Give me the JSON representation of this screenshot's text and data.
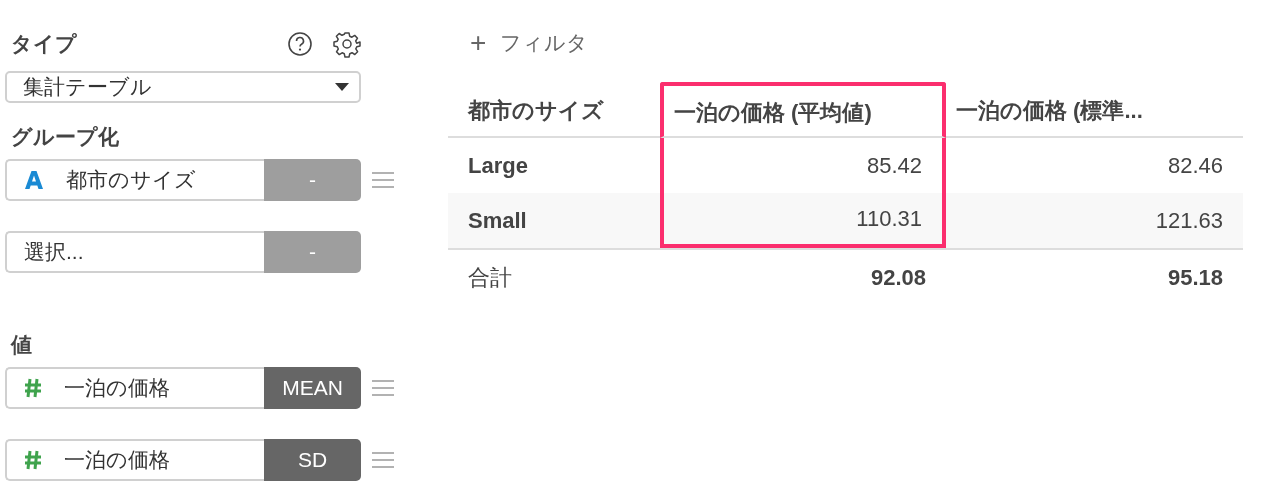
{
  "sidebar": {
    "type_label": "タイプ",
    "type_select": {
      "value": "集計テーブル"
    },
    "group_label": "グループ化",
    "group_fields": [
      {
        "kind": "text",
        "value": "都市のサイズ",
        "agg": "-"
      },
      {
        "kind": "empty",
        "placeholder": "選択...",
        "agg": "-"
      }
    ],
    "value_label": "値",
    "value_fields": [
      {
        "kind": "number",
        "value": "一泊の価格",
        "agg": "MEAN"
      },
      {
        "kind": "number",
        "value": "一泊の価格",
        "agg": "SD"
      }
    ]
  },
  "filter_button": {
    "icon": "+",
    "label": "フィルタ"
  },
  "table": {
    "columns": [
      {
        "label": "都市のサイズ",
        "highlighted": false
      },
      {
        "label": "一泊の価格 (平均値)",
        "highlighted": true
      },
      {
        "label": "一泊の価格 (標準...",
        "highlighted": false
      }
    ],
    "rows": [
      [
        "Large",
        "85.42",
        "82.46"
      ],
      [
        "Small",
        "110.31",
        "121.63"
      ]
    ],
    "total": [
      "合計",
      "92.08",
      "95.18"
    ]
  }
}
